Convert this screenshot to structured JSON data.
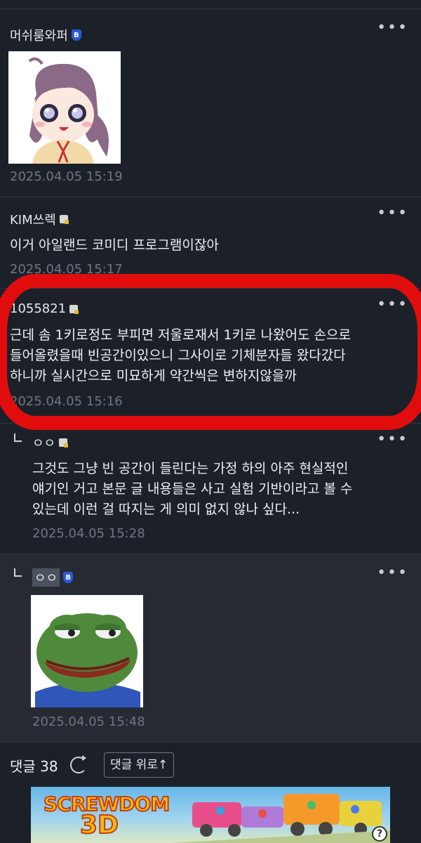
{
  "comments": [
    {
      "author": "머쉬룸와퍼",
      "badge": "B",
      "text": "",
      "time": "2025.04.05 15:19",
      "image": "anime-girl-sticker"
    },
    {
      "author": "KIM쓰렉",
      "badge": "pen",
      "text": "이거 아일랜드 코미디 프로그램이잖아",
      "time": "2025.04.05 15:17"
    },
    {
      "author": "1055821",
      "badge": "pen",
      "text_lines": [
        "근데 솜 1키로정도 부피면 저울로재서 1키로 나왔어도 손으로",
        "들어올렸을때 빈공간이있으니 그사이로 기체분자들 왔다갔다",
        "하니까 실시간으로 미묘하게 약간씩은 변하지않을까"
      ],
      "time": "2025.04.05 15:16"
    },
    {
      "author": "ㅇㅇ",
      "badge": "pen",
      "is_reply": true,
      "text_lines": [
        "그것도 그냥 빈 공간이 들린다는 가정 하의 아주 현실적인",
        "얘기인 거고 본문 글 내용들은 사고 실험 기반이라고 볼 수",
        "있는데 이런 걸 따지는 게 의미 없지 않나 싶다..."
      ],
      "time": "2025.04.05 15:28"
    },
    {
      "author": "ㅇㅇ",
      "badge": "B",
      "is_reply": true,
      "text": "",
      "time": "2025.04.05 15:48",
      "image": "pepe-frog-sticker"
    }
  ],
  "more_label": "•••",
  "footer": {
    "count_label": "댓글 38",
    "up_button": "댓글 위로↑"
  },
  "ad": {
    "logo_line1": "SCREWDOM",
    "logo_line2": "3D",
    "help": "?"
  },
  "colors": {
    "background": "#1c2129",
    "highlight": "#e10d0d",
    "badge_blue": "#2b5bd7"
  }
}
